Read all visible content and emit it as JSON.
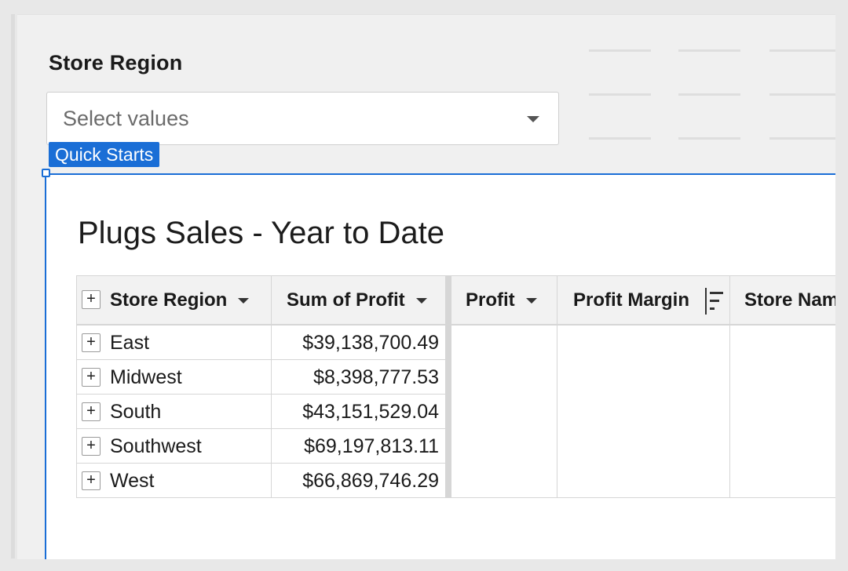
{
  "filter": {
    "label": "Store Region",
    "placeholder": "Select values"
  },
  "element": {
    "tag": "Quick Starts",
    "title": "Plugs Sales - Year to Date"
  },
  "table": {
    "columns": [
      "Store Region",
      "Sum of Profit",
      "Profit",
      "Profit Margin",
      "Store Name"
    ],
    "rows": [
      {
        "region": "East",
        "profit": "$39,138,700.49"
      },
      {
        "region": "Midwest",
        "profit": "$8,398,777.53"
      },
      {
        "region": "South",
        "profit": "$43,151,529.04"
      },
      {
        "region": "Southwest",
        "profit": "$69,197,813.11"
      },
      {
        "region": "West",
        "profit": "$66,869,746.29"
      }
    ]
  },
  "colors": {
    "accent": "#1a6ed6",
    "header_bg": "#f2f2f2",
    "canvas_bg": "#f0f0f0"
  },
  "icons": [
    "expand-plus-icon",
    "chevron-down-icon",
    "sort-icon"
  ]
}
